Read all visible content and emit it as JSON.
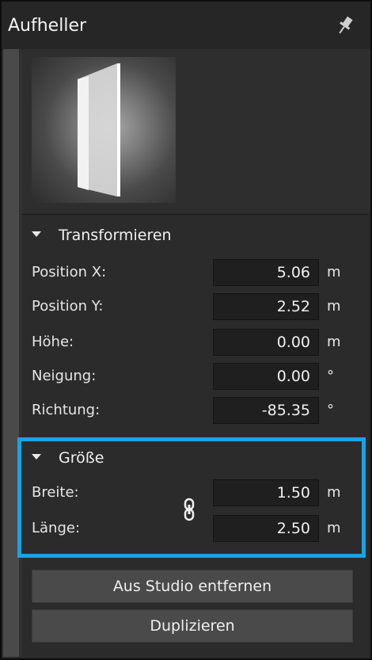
{
  "panel": {
    "title": "Aufheller"
  },
  "icons": {
    "pin": "pin-icon",
    "link": "chain-link-icon",
    "collapse": "triangle-down-icon"
  },
  "transform": {
    "header": "Transformieren",
    "rows": [
      {
        "label": "Position X:",
        "value": "5.06",
        "unit": "m"
      },
      {
        "label": "Position Y:",
        "value": "2.52",
        "unit": "m"
      },
      {
        "label": "Höhe:",
        "value": "0.00",
        "unit": "m"
      },
      {
        "label": "Neigung:",
        "value": "0.00",
        "unit": "°"
      },
      {
        "label": "Richtung:",
        "value": "-85.35",
        "unit": "°"
      }
    ]
  },
  "size": {
    "header": "Größe",
    "rows": [
      {
        "label": "Breite:",
        "value": "1.50",
        "unit": "m"
      },
      {
        "label": "Länge:",
        "value": "2.50",
        "unit": "m"
      }
    ]
  },
  "actions": {
    "remove_label": "Aus Studio entfernen",
    "duplicate_label": "Duplizieren"
  },
  "colors": {
    "highlight": "#17a3e6",
    "panel_bg": "#2b2b2b",
    "field_bg": "#1f1f1f"
  }
}
